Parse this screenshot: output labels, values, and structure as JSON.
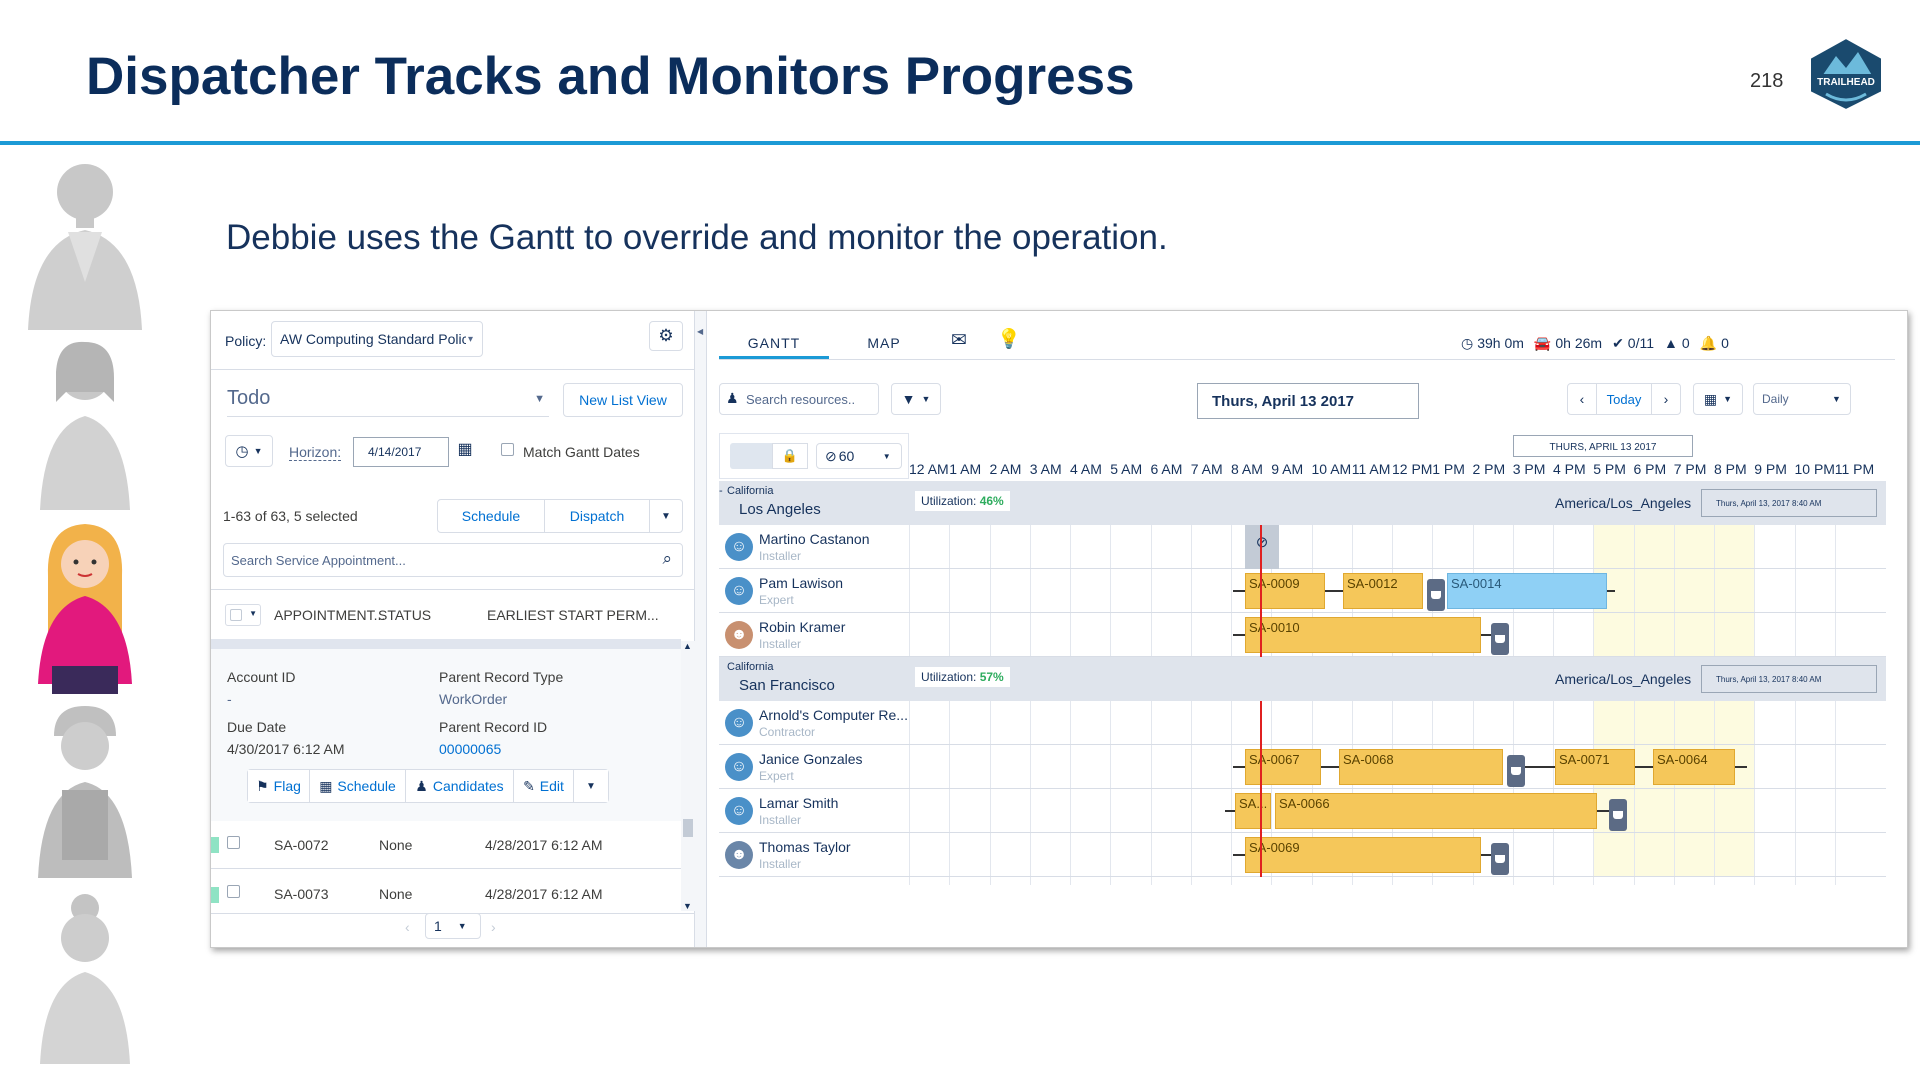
{
  "slide": {
    "title": "Dispatcher Tracks and Monitors Progress",
    "page_number": "218",
    "logo_text": "TRAILHEAD",
    "subtitle": "Debbie uses the Gantt to override and monitor the operation."
  },
  "left_panel": {
    "policy_label": "Policy:",
    "policy_value": "AW Computing Standard Policy",
    "list_view": "Todo",
    "new_list_view": "New List View",
    "horizon_label": "Horizon:",
    "horizon_value": "4/14/2017",
    "match_gantt_dates": "Match Gantt Dates",
    "count_text": "1-63 of 63, 5 selected",
    "schedule_button": "Schedule",
    "dispatch_button": "Dispatch",
    "search_placeholder": "Search Service Appointment...",
    "columns": [
      "APPOINTMENT...",
      "STATUS",
      "EARLIEST START PERM..."
    ],
    "detail": {
      "account_id_label": "Account ID",
      "account_id_value": "-",
      "parent_type_label": "Parent Record Type",
      "parent_type_value": "WorkOrder",
      "due_date_label": "Due Date",
      "due_date_value": "4/30/2017 6:12 AM",
      "parent_id_label": "Parent Record ID",
      "parent_id_value": "00000065"
    },
    "actions": [
      "Flag",
      "Schedule",
      "Candidates",
      "Edit"
    ],
    "rows": [
      {
        "id": "SA-0072",
        "status": "None",
        "date": "4/28/2017 6:12 AM"
      },
      {
        "id": "SA-0073",
        "status": "None",
        "date": "4/28/2017 6:12 AM"
      }
    ],
    "page": "1"
  },
  "right_panel": {
    "tabs": [
      "GANTT",
      "MAP"
    ],
    "stats": {
      "hours": "39h 0m",
      "travel": "0h 26m",
      "done": "0/11",
      "warnings": "0",
      "alerts": "0"
    },
    "search_resources": "Search resources..",
    "date_display": "Thurs, April 13 2017",
    "today_button": "Today",
    "view_mode": "Daily",
    "zoom_value": "60",
    "date_header": "THURS, APRIL 13 2017",
    "hours": [
      "12 AM",
      "1 AM",
      "2 AM",
      "3 AM",
      "4 AM",
      "5 AM",
      "6 AM",
      "7 AM",
      "8 AM",
      "9 AM",
      "10 AM",
      "11 AM",
      "12 PM",
      "1 PM",
      "2 PM",
      "3 PM",
      "4 PM",
      "5 PM",
      "6 PM",
      "7 PM",
      "8 PM",
      "9 PM",
      "10 PM",
      "11 PM"
    ],
    "territories": [
      {
        "region": "California",
        "name": "Los Angeles",
        "utilization_label": "Utilization:",
        "utilization": "46%",
        "timezone": "America/Los_Angeles",
        "now": "Thurs, April 13, 2017 8:40 AM",
        "resources": [
          {
            "name": "Martino Castanon",
            "role": "Installer",
            "bars": []
          },
          {
            "name": "Pam Lawison",
            "role": "Expert",
            "bars": [
              "SA-0009",
              "SA-0012",
              "SA-0014"
            ]
          },
          {
            "name": "Robin Kramer",
            "role": "Installer",
            "bars": [
              "SA-0010"
            ]
          }
        ]
      },
      {
        "region": "California",
        "name": "San Francisco",
        "utilization_label": "Utilization:",
        "utilization": "57%",
        "timezone": "America/Los_Angeles",
        "now": "Thurs, April 13, 2017 8:40 AM",
        "resources": [
          {
            "name": "Arnold's Computer Re...",
            "role": "Contractor",
            "bars": []
          },
          {
            "name": "Janice Gonzales",
            "role": "Expert",
            "bars": [
              "SA-0067",
              "SA-0068",
              "SA-0071",
              "SA-0064"
            ]
          },
          {
            "name": "Lamar Smith",
            "role": "Installer",
            "bars": [
              "SA...",
              "SA-0066"
            ]
          },
          {
            "name": "Thomas Taylor",
            "role": "Installer",
            "bars": [
              "SA-0069"
            ]
          }
        ]
      }
    ]
  },
  "colors": {
    "accent": "#1c9ad6",
    "title": "#0b2d5b",
    "bar": "#f5c75a",
    "bar_blue": "#8fd0f5",
    "now_line": "#e02020"
  }
}
